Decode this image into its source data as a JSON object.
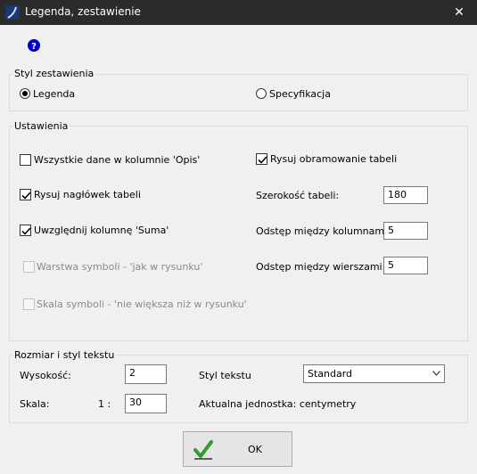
{
  "window": {
    "title": "Legenda, zestawienie",
    "close_glyph": "✕"
  },
  "help_glyph": "?",
  "styl_zestawienia": {
    "legend": "Styl zestawienia",
    "options": [
      {
        "label": "Legenda",
        "selected": true
      },
      {
        "label": "Specyfikacja",
        "selected": false
      }
    ]
  },
  "ustawienia": {
    "legend": "Ustawienia",
    "wszystkie_dane": {
      "label": "Wszystkie dane w kolumnie 'Opis'",
      "checked": false
    },
    "rysuj_naglowek": {
      "label": "Rysuj nagłówek tabeli",
      "checked": true
    },
    "uwzglednij_suma": {
      "label": "Uwzględnij kolumnę 'Suma'",
      "checked": true
    },
    "warstwa_symboli": {
      "label": "Warstwa symboli - 'jak w rysunku'",
      "checked": false,
      "disabled": true
    },
    "skala_symboli": {
      "label": "Skala symboli - 'nie większa niż w rysunku'",
      "checked": false,
      "disabled": true
    },
    "rysuj_obramowanie": {
      "label": "Rysuj obramowanie tabeli",
      "checked": true
    },
    "szerokosc": {
      "label": "Szerokość tabeli:",
      "value": "180"
    },
    "odstep_kolumny": {
      "label": "Odstęp między kolumnami:",
      "value": "5"
    },
    "odstep_wiersze": {
      "label": "Odstęp między wierszami:",
      "value": "5"
    }
  },
  "rozmiar": {
    "legend": "Rozmiar i styl tekstu",
    "wysokosc": {
      "label": "Wysokość:",
      "value": "2"
    },
    "skala": {
      "label": "Skala:",
      "prefix": "1 :",
      "value": "30"
    },
    "styl_tekstu": {
      "label": "Styl tekstu",
      "value": "Standard"
    },
    "jednostka": "Aktualna jednostka: centymetry"
  },
  "ok_button": {
    "label": "OK"
  },
  "colors": {
    "titlebar": "#2b2b2b",
    "check_green": "#2f9e2f",
    "help_blue": "#0000c8"
  },
  "icons": [
    "app-icon",
    "close-icon",
    "help-icon",
    "checkmark-icon",
    "chevron-down-icon"
  ]
}
